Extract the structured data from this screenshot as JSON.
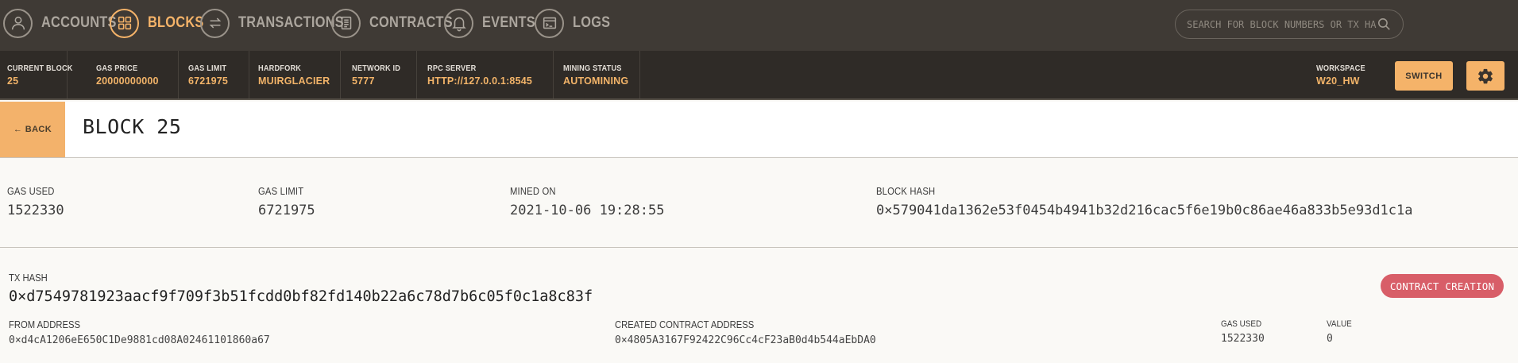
{
  "nav": {
    "items": [
      {
        "label": "ACCOUNTS",
        "icon": "person-icon"
      },
      {
        "label": "BLOCKS",
        "icon": "grid-icon"
      },
      {
        "label": "TRANSACTIONS",
        "icon": "swap-arrows-icon"
      },
      {
        "label": "CONTRACTS",
        "icon": "document-icon"
      },
      {
        "label": "EVENTS",
        "icon": "bell-icon"
      },
      {
        "label": "LOGS",
        "icon": "terminal-icon"
      }
    ],
    "active": "BLOCKS"
  },
  "search": {
    "placeholder": "SEARCH FOR BLOCK NUMBERS OR TX HASHES"
  },
  "status": {
    "current_block": {
      "label": "CURRENT BLOCK",
      "value": "25"
    },
    "gas_price": {
      "label": "GAS PRICE",
      "value": "20000000000"
    },
    "gas_limit": {
      "label": "GAS LIMIT",
      "value": "6721975"
    },
    "hardfork": {
      "label": "HARDFORK",
      "value": "MUIRGLACIER"
    },
    "network_id": {
      "label": "NETWORK ID",
      "value": "5777"
    },
    "rpc_server": {
      "label": "RPC SERVER",
      "value": "HTTP://127.0.0.1:8545"
    },
    "mining_status": {
      "label": "MINING STATUS",
      "value": "AUTOMINING"
    },
    "workspace": {
      "label": "WORKSPACE",
      "value": "W20_HW"
    },
    "switch_label": "SWITCH"
  },
  "block": {
    "back_label": "← BACK",
    "title": "BLOCK 25",
    "gas_used": {
      "label": "GAS USED",
      "value": "1522330"
    },
    "gas_limit": {
      "label": "GAS LIMIT",
      "value": "6721975"
    },
    "mined_on": {
      "label": "MINED ON",
      "value": "2021-10-06 19:28:55"
    },
    "block_hash": {
      "label": "BLOCK HASH",
      "value": "0×579041da1362e53f0454b4941b32d216cac5f6e19b0c86ae46a833b5e93d1c1a"
    }
  },
  "transaction": {
    "hash_label": "TX HASH",
    "hash": "0×d7549781923aacf9f709f3b51fcdd0bf82fd140b22a6c78d7b6c05f0c1a8c83f",
    "badge": "CONTRACT CREATION",
    "from": {
      "label": "FROM ADDRESS",
      "value": "0×d4cA1206eE650C1De9881cd08A02461101860a67"
    },
    "created_contract": {
      "label": "CREATED CONTRACT ADDRESS",
      "value": "0×4805A3167F92422C96Cc4cF23aB0d4b544aEbDA0"
    },
    "gas_used": {
      "label": "GAS USED",
      "value": "1522330"
    },
    "value": {
      "label": "VALUE",
      "value": "0"
    }
  },
  "colors": {
    "accent": "#f5b369",
    "nav_bg": "#3f3a35",
    "status_bg": "#2f2b27",
    "badge": "#d85e68"
  }
}
